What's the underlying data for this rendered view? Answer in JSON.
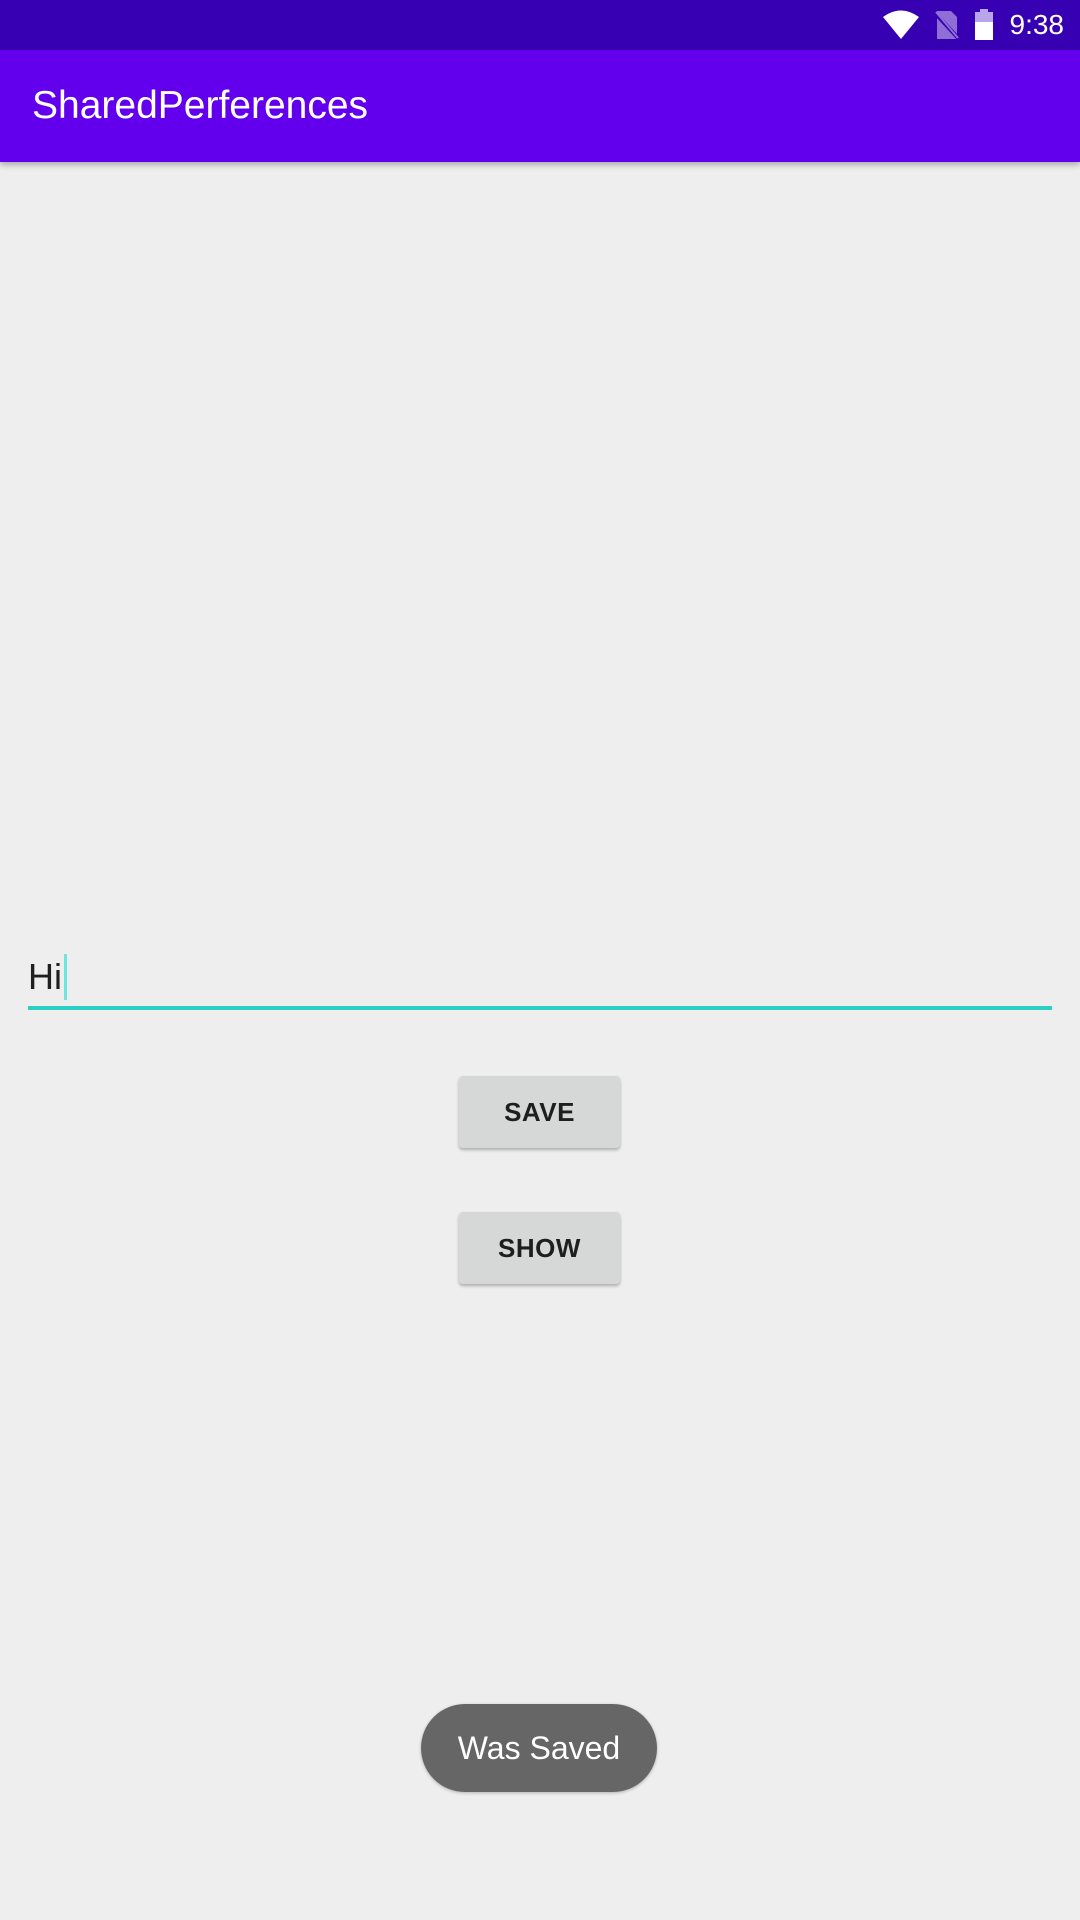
{
  "status_bar": {
    "time": "9:38",
    "icons": [
      "wifi-icon",
      "no-sim-icon",
      "battery-icon"
    ],
    "color": "#3700b3"
  },
  "app_bar": {
    "title": "SharedPerferences",
    "color": "#6200ee"
  },
  "form": {
    "input_value": "Hi",
    "underline_color": "#2ccfc4",
    "save_label": "SAVE",
    "show_label": "SHOW"
  },
  "toast": {
    "message": "Was Saved"
  }
}
